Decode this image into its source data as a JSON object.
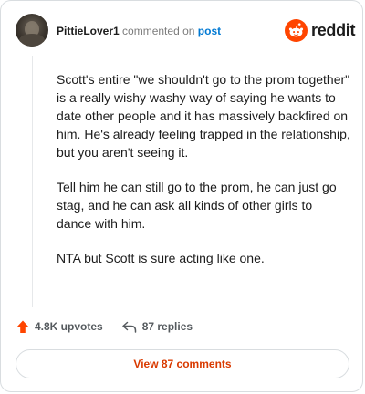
{
  "comment": {
    "username": "PittieLover1",
    "action_text": "commented on",
    "post_link": "post",
    "paragraphs": [
      "Scott's entire \"we shouldn't go to the prom together\" is a really wishy washy way of saying he wants to date other people and it has massively backfired on him. He's already feeling trapped in the relationship, but you aren't seeing it.",
      "Tell him he can still go to the prom, he can just go stag, and he can ask all kinds of other girls to dance with him.",
      "NTA but Scott is sure acting like one."
    ]
  },
  "brand": {
    "wordmark": "reddit",
    "color": "#ff4500"
  },
  "actions": {
    "upvotes": "4.8K upvotes",
    "replies": "87 replies"
  },
  "footer": {
    "view_comments_label": "View 87 comments"
  },
  "icons": {
    "upvote": "upvote-arrow-icon",
    "reply": "reply-arrow-icon",
    "logo": "reddit-snoo-icon"
  },
  "colors": {
    "upvote": "#ff4500",
    "link": "#0079d3",
    "view_button_text": "#d93a00"
  }
}
